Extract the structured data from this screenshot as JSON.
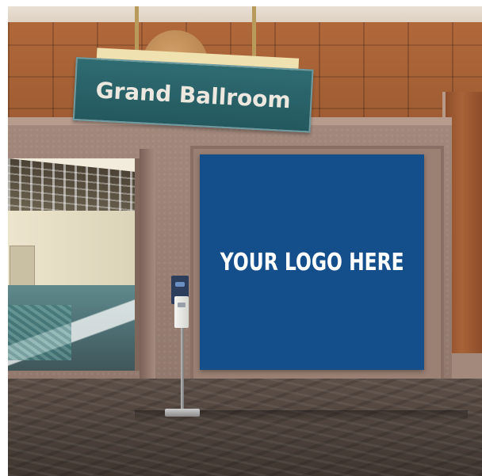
{
  "scene": {
    "description_labels": {
      "sign_text": "Grand Ballroom",
      "banner_text": "YOUR LOGO HERE"
    }
  },
  "colors": {
    "sign_teal": "#2f6c72",
    "banner_blue": "#154f8b",
    "wood": "#a86338",
    "stone": "#9b8174"
  }
}
